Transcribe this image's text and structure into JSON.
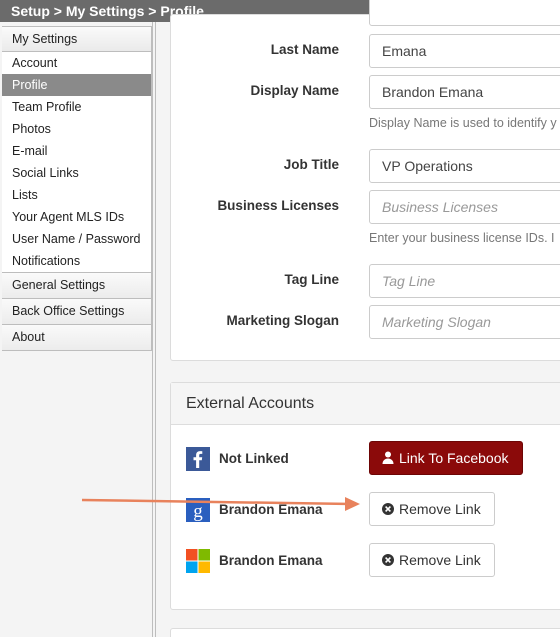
{
  "breadcrumb": "Setup > My Settings > Profile",
  "sidebar": {
    "header": "My Settings",
    "items": [
      {
        "label": "Account",
        "active": false
      },
      {
        "label": "Profile",
        "active": true
      },
      {
        "label": "Team Profile",
        "active": false
      },
      {
        "label": "Photos",
        "active": false
      },
      {
        "label": "E-mail",
        "active": false
      },
      {
        "label": "Social Links",
        "active": false
      },
      {
        "label": "Lists",
        "active": false
      },
      {
        "label": "Your Agent MLS IDs",
        "active": false
      },
      {
        "label": "User Name / Password",
        "active": false
      },
      {
        "label": "Notifications",
        "active": false
      }
    ],
    "sections": [
      "General Settings",
      "Back Office Settings",
      "About"
    ]
  },
  "form": {
    "last_name": {
      "label": "Last Name",
      "value": "Emana"
    },
    "display_name": {
      "label": "Display Name",
      "value": "Brandon Emana",
      "help": "Display Name is used to identify y"
    },
    "job_title": {
      "label": "Job Title",
      "value": "VP Operations"
    },
    "business_licenses": {
      "label": "Business Licenses",
      "placeholder": "Business Licenses",
      "help": "Enter your business license IDs. I"
    },
    "tag_line": {
      "label": "Tag Line",
      "placeholder": "Tag Line"
    },
    "marketing_slogan": {
      "label": "Marketing Slogan",
      "placeholder": "Marketing Slogan"
    }
  },
  "external": {
    "title": "External Accounts",
    "accounts": [
      {
        "service": "facebook",
        "icon": "facebook-icon",
        "name": "Not Linked",
        "action": "Link To Facebook"
      },
      {
        "service": "google",
        "icon": "google-icon",
        "name": "Brandon Emana",
        "action": "Remove Link"
      },
      {
        "service": "microsoft",
        "icon": "microsoft-icon",
        "name": "Brandon Emana",
        "action": "Remove Link"
      }
    ]
  },
  "colors": {
    "facebook_button": "#8b0a0a",
    "annotation_arrow": "#e8825c",
    "sidebar_active": "#8a8a8a"
  }
}
